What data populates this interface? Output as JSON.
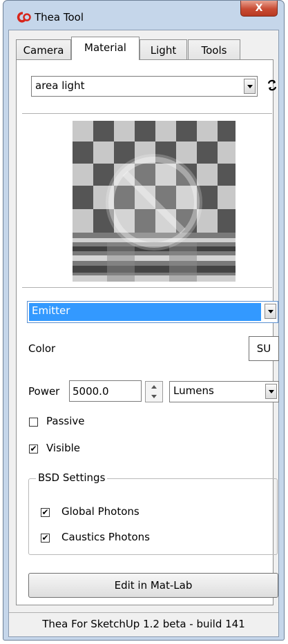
{
  "window": {
    "title": "Thea Tool",
    "close_label": "X"
  },
  "tabs": [
    {
      "label": "Camera",
      "active": false
    },
    {
      "label": "Material",
      "active": true
    },
    {
      "label": "Light",
      "active": false
    },
    {
      "label": "Tools",
      "active": false
    }
  ],
  "material": {
    "selected": "area light",
    "refresh_icon": "refresh-icon",
    "preview_icon": "material-preview-checkerboard"
  },
  "layer": {
    "selected": "Emitter"
  },
  "color": {
    "label": "Color",
    "button_label": "SU"
  },
  "power": {
    "label": "Power",
    "value": "5000.0",
    "unit": "Lumens"
  },
  "passive": {
    "label": "Passive",
    "checked": false
  },
  "visible": {
    "label": "Visible",
    "checked": true
  },
  "bsd": {
    "title": "BSD Settings",
    "global_photons": {
      "label": "Global Photons",
      "checked": true
    },
    "caustics_photons": {
      "label": "Caustics Photons",
      "checked": true
    }
  },
  "edit_button_label": "Edit in Mat-Lab",
  "status": "Thea For SketchUp 1.2 beta - build 141",
  "colors": {
    "accent_selection": "#3399ff",
    "close_red": "#c84b33",
    "frame": "#c5d6ea"
  }
}
